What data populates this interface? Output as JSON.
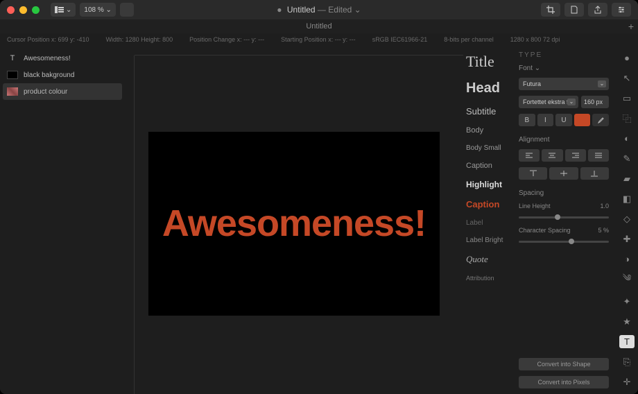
{
  "titlebar": {
    "zoom": "108 % ⌄",
    "title": "Untitled",
    "state": "Edited ⌄",
    "dirty_marker": "●"
  },
  "tab": {
    "name": "Untitled",
    "plus": "+"
  },
  "infobar": {
    "cursor": "Cursor Position x: 699   y: -410",
    "size": "Width: 1280   Height: 800",
    "poschange": "Position Change x: ---   y: ---",
    "startpos": "Starting Position x: ---   y: ---",
    "colorspace": "sRGB IEC61966-21",
    "bits": "8-bits per channel",
    "dims": "1280 x 800 72 dpi"
  },
  "layers": [
    {
      "name": "Awesomeness!",
      "icon": "T",
      "selected": false
    },
    {
      "name": "black bakground",
      "icon": "black",
      "selected": false
    },
    {
      "name": "product colour",
      "icon": "pink",
      "selected": true
    }
  ],
  "canvas": {
    "text": "Awesomeness!",
    "text_color": "#c54826"
  },
  "styles": [
    {
      "label": "Title",
      "cls": "style-title"
    },
    {
      "label": "Head",
      "cls": "style-head"
    },
    {
      "label": "Subtitle",
      "cls": "style-subtitle"
    },
    {
      "label": "Body",
      "cls": "style-body"
    },
    {
      "label": "Body Small",
      "cls": "style-bodysmall"
    },
    {
      "label": "Caption",
      "cls": "style-caption1"
    },
    {
      "label": "Highlight",
      "cls": "style-highlight"
    },
    {
      "label": "Caption",
      "cls": "style-caption2"
    },
    {
      "label": "Label",
      "cls": "style-label"
    },
    {
      "label": "Label Bright",
      "cls": "style-labelbright"
    },
    {
      "label": "Quote",
      "cls": "style-quote"
    },
    {
      "label": "Attribution",
      "cls": "style-attribution"
    }
  ],
  "inspector": {
    "type_header": "TYPE",
    "font_label": "Font ⌄",
    "font_family": "Futura",
    "font_weight": "Fortettet ekstra fet",
    "font_size": "160 px",
    "bold": "B",
    "italic": "I",
    "underline": "U",
    "alignment_label": "Alignment",
    "spacing_label": "Spacing",
    "line_height_label": "Line Height",
    "line_height_value": "1.0",
    "char_spacing_label": "Character Spacing",
    "char_spacing_value": "5 %",
    "convert_shape": "Convert into Shape",
    "convert_pixels": "Convert into Pixels"
  },
  "tools": [
    "blob",
    "arrow",
    "marquee",
    "crop",
    "lasso",
    "pen",
    "bucket",
    "gradient",
    "erase",
    "heal",
    "contrast",
    "warp",
    "magic",
    "star",
    "type",
    "clone",
    "picker"
  ],
  "tool_glyphs": {
    "blob": "●",
    "arrow": "↖",
    "marquee": "▭",
    "crop": "⿻",
    "lasso": "◐",
    "pen": "✎",
    "bucket": "▰",
    "gradient": "◧",
    "erase": "◇",
    "heal": "✚",
    "contrast": "◑",
    "warp": "༄",
    "magic": "✦",
    "star": "★",
    "type": "T",
    "clone": "⎘",
    "picker": "✛"
  },
  "active_tool": "type"
}
